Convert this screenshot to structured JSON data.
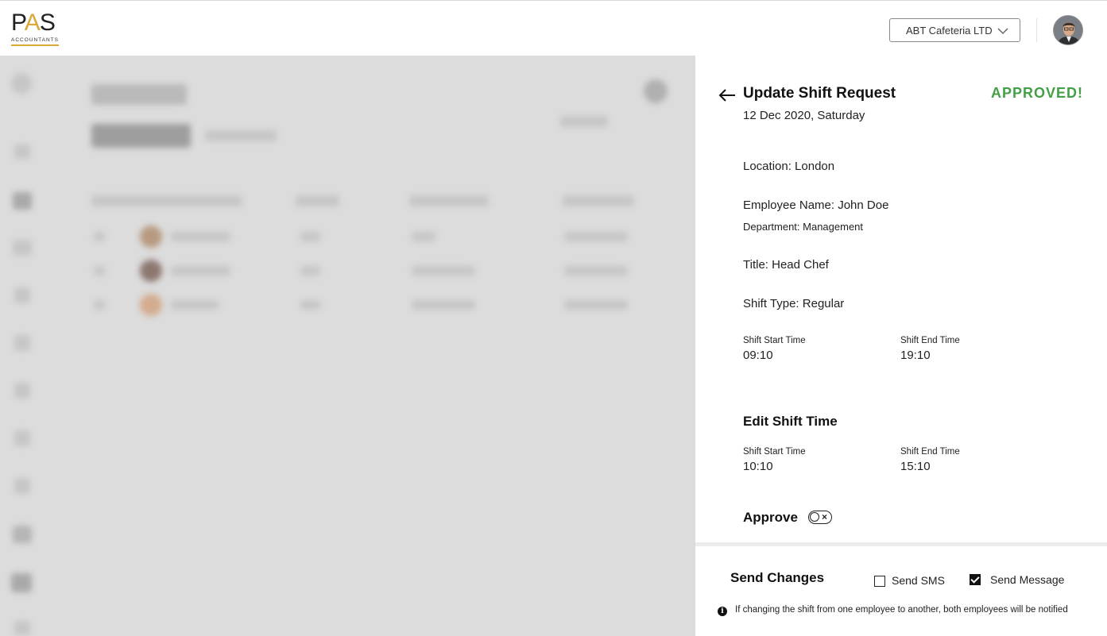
{
  "header": {
    "logo_text": "PAS",
    "logo_sub": "ACCOUNTANTS",
    "company_select_value": "ABT Cafeteria LTD"
  },
  "panel": {
    "title": "Update Shift Request",
    "status": "APPROVED!",
    "date": "12 Dec 2020, Saturday",
    "location": "Location: London",
    "employee_name": "Employee Name: John Doe",
    "department": "Department: Management",
    "job_title": "Title: Head Chef",
    "shift_type": "Shift Type: Regular",
    "current_shift": {
      "start_label": "Shift Start Time",
      "start_value": "09:10",
      "end_label": "Shift End Time",
      "end_value": "19:10"
    },
    "edit_section_title": "Edit Shift Time",
    "edit_shift": {
      "start_label": "Shift Start Time",
      "start_value": "10:10",
      "end_label": "Shift End Time",
      "end_value": "15:10"
    },
    "approve_label": "Approve",
    "approve_on": false
  },
  "footer": {
    "title": "Send Changes",
    "send_sms_label": "Send SMS",
    "send_sms_checked": false,
    "send_message_label": "Send Message",
    "send_message_checked": true,
    "info_text": "If changing the shift from one employee to another, both employees will be notified"
  },
  "colors": {
    "approved": "#43a047",
    "overlay": "#dcdcdc",
    "logo_accent": "#d9a93a"
  }
}
